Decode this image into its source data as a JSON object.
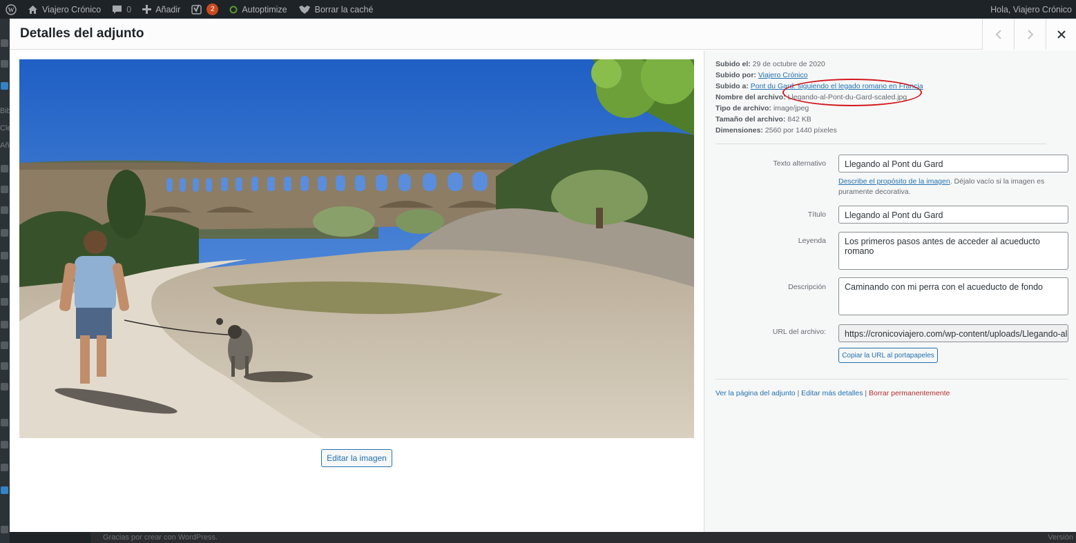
{
  "adminbar": {
    "site_name": "Viajero Crónico",
    "comments_count": "0",
    "add_new": "Añadir",
    "yoast_badge": "2",
    "autoptimize": "Autoptimize",
    "clear_cache": "Borrar la caché",
    "greeting": "Hola, Viajero Crónico"
  },
  "background": {
    "footer_text": "Gracias por crear con WordPress.",
    "version": "Versión"
  },
  "modal": {
    "title": "Detalles del adjunto",
    "edit_image_button": "Editar la imagen",
    "image_alt": "Llegando al Pont du Gard"
  },
  "details": {
    "uploaded_on_label": "Subido el:",
    "uploaded_on": "29 de octubre de 2020",
    "uploaded_by_label": "Subido por:",
    "uploaded_by": "Viajero Crónico",
    "uploaded_to_label": "Subido a:",
    "uploaded_to": "Pont du Gard: siguiendo el legado romano en Francia",
    "filename_label": "Nombre del archivo:",
    "filename": "Llegando-al-Pont-du-Gard-scaled.jpg",
    "filetype_label": "Tipo de archivo:",
    "filetype": "image/jpeg",
    "filesize_label": "Tamaño del archivo:",
    "filesize": "842 KB",
    "dimensions_label": "Dimensiones:",
    "dimensions": "2560 por 1440 píxeles"
  },
  "fields": {
    "alt_label": "Texto alternativo",
    "alt_value": "Llegando al Pont du Gard",
    "alt_hint_link": "Describe el propósito de la imagen",
    "alt_hint_rest": ". Déjalo vacío si la imagen es puramente decorativa.",
    "title_label": "Título",
    "title_value": "Llegando al Pont du Gard",
    "caption_label": "Leyenda",
    "caption_value": "Los primeros pasos antes de acceder al acueducto romano",
    "description_label": "Descripción",
    "description_value": "Caminando con mi perra con el acueducto de fondo",
    "url_label": "URL del archivo:",
    "url_value": "https://cronicoviajero.com/wp-content/uploads/Llegando-al-Pont-du-Gard-scaled.jpg",
    "copy_button": "Copiar la URL al portapapeles"
  },
  "actions": {
    "view_page": "Ver la página del adjunto",
    "separator": " | ",
    "edit_more": "Editar más detalles",
    "delete": "Borrar permanentemente"
  },
  "colors": {
    "accent": "#2271b1",
    "danger": "#b32d2e",
    "annotation": "#d3181c"
  }
}
